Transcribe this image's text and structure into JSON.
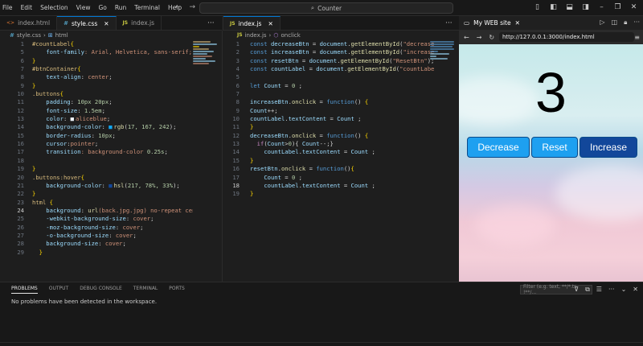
{
  "menu": [
    "File",
    "Edit",
    "Selection",
    "View",
    "Go",
    "Run",
    "Terminal",
    "Help"
  ],
  "command_center": {
    "text": "Counter"
  },
  "left_group": {
    "tabs": [
      {
        "label": "index.html",
        "type": "html"
      },
      {
        "label": "style.css",
        "type": "css",
        "active": true
      },
      {
        "label": "index.js",
        "type": "js"
      }
    ],
    "breadcrumb": {
      "file": "style.css",
      "symbol": "html"
    }
  },
  "mid_group": {
    "tabs": [
      {
        "label": "index.js",
        "type": "js",
        "active": true
      }
    ],
    "breadcrumb": {
      "file": "index.js",
      "symbol": "onclick"
    }
  },
  "css_lines": [
    "1",
    "5",
    "6",
    "7",
    "8",
    "9",
    "10",
    "11",
    "12",
    "13",
    "14",
    "15",
    "16",
    "17",
    "18",
    "19",
    "20",
    "21",
    "22",
    "23",
    "24",
    "25",
    "26",
    "27",
    "28",
    "29"
  ],
  "css_current_line": "24",
  "css_code": [
    [
      {
        "t": "#countLabel",
        "c": "sel"
      },
      {
        "t": "{",
        "c": "brk"
      }
    ],
    [
      {
        "t": "    font-family",
        "c": "prop"
      },
      {
        "t": ": Arial, Helvetica, sans-serif;",
        "c": "str"
      }
    ],
    [
      {
        "t": "}",
        "c": "brk"
      }
    ],
    [
      {
        "t": "#btnContainer",
        "c": "sel"
      },
      {
        "t": "{",
        "c": "brk"
      }
    ],
    [
      {
        "t": "    text-align",
        "c": "prop"
      },
      {
        "t": ": ",
        "c": "txt"
      },
      {
        "t": "center",
        "c": "str"
      },
      {
        "t": ";",
        "c": "txt"
      }
    ],
    [
      {
        "t": "}",
        "c": "brk"
      }
    ],
    [
      {
        "t": ".buttons",
        "c": "sel"
      },
      {
        "t": "{",
        "c": "brk"
      }
    ],
    [
      {
        "t": "    padding",
        "c": "prop"
      },
      {
        "t": ": ",
        "c": "txt"
      },
      {
        "t": "10px 20px",
        "c": "num"
      },
      {
        "t": ";",
        "c": "txt"
      }
    ],
    [
      {
        "t": "    font-size",
        "c": "prop"
      },
      {
        "t": ": ",
        "c": "txt"
      },
      {
        "t": "1.5em",
        "c": "num"
      },
      {
        "t": ";",
        "c": "txt"
      }
    ],
    [
      {
        "t": "    color",
        "c": "prop"
      },
      {
        "t": ": ",
        "c": "txt"
      },
      {
        "t": "■",
        "c": "sw1"
      },
      {
        "t": "aliceblue",
        "c": "str"
      },
      {
        "t": ";",
        "c": "txt"
      }
    ],
    [
      {
        "t": "    background-color",
        "c": "prop"
      },
      {
        "t": ": ",
        "c": "txt"
      },
      {
        "t": "■",
        "c": "sw2"
      },
      {
        "t": "rgb",
        "c": "fn"
      },
      {
        "t": "(",
        "c": "txt"
      },
      {
        "t": "17, 167, 242",
        "c": "num"
      },
      {
        "t": ");",
        "c": "txt"
      }
    ],
    [
      {
        "t": "    border-radius",
        "c": "prop"
      },
      {
        "t": ": ",
        "c": "txt"
      },
      {
        "t": "10px",
        "c": "num"
      },
      {
        "t": ";",
        "c": "txt"
      }
    ],
    [
      {
        "t": "    cursor",
        "c": "prop"
      },
      {
        "t": ":",
        "c": "txt"
      },
      {
        "t": "pointer",
        "c": "str"
      },
      {
        "t": ";",
        "c": "txt"
      }
    ],
    [
      {
        "t": "    transition",
        "c": "prop"
      },
      {
        "t": ": background-color ",
        "c": "str"
      },
      {
        "t": "0.25s",
        "c": "num"
      },
      {
        "t": ";",
        "c": "txt"
      }
    ],
    [
      {
        "t": "",
        "c": "txt"
      }
    ],
    [
      {
        "t": "}",
        "c": "brk"
      }
    ],
    [
      {
        "t": ".buttons:hover",
        "c": "sel"
      },
      {
        "t": "{",
        "c": "brk"
      }
    ],
    [
      {
        "t": "    background-color",
        "c": "prop"
      },
      {
        "t": ": ",
        "c": "txt"
      },
      {
        "t": "■",
        "c": "sw3"
      },
      {
        "t": "hsl",
        "c": "fn"
      },
      {
        "t": "(",
        "c": "txt"
      },
      {
        "t": "217, 78%, 33%",
        "c": "num"
      },
      {
        "t": ");",
        "c": "txt"
      }
    ],
    [
      {
        "t": "}",
        "c": "brk"
      }
    ],
    [
      {
        "t": "html ",
        "c": "sel"
      },
      {
        "t": "{",
        "c": "brk"
      }
    ],
    [
      {
        "t": "    background",
        "c": "prop"
      },
      {
        "t": ": ",
        "c": "txt"
      },
      {
        "t": "url",
        "c": "fn"
      },
      {
        "t": "(back.jpg.jpg)",
        "c": "str"
      },
      {
        "t": " no-repeat cente",
        "c": "str"
      }
    ],
    [
      {
        "t": "    -webkit-background-size",
        "c": "prop"
      },
      {
        "t": ": ",
        "c": "txt"
      },
      {
        "t": "cover",
        "c": "str"
      },
      {
        "t": ";",
        "c": "txt"
      }
    ],
    [
      {
        "t": "    -moz-background-size",
        "c": "prop"
      },
      {
        "t": ": ",
        "c": "txt"
      },
      {
        "t": "cover",
        "c": "str"
      },
      {
        "t": ";",
        "c": "txt"
      }
    ],
    [
      {
        "t": "    -o-background-size",
        "c": "prop"
      },
      {
        "t": ": ",
        "c": "txt"
      },
      {
        "t": "cover",
        "c": "str"
      },
      {
        "t": ";",
        "c": "txt"
      }
    ],
    [
      {
        "t": "    background-size",
        "c": "prop"
      },
      {
        "t": ": ",
        "c": "txt"
      },
      {
        "t": "cover",
        "c": "str"
      },
      {
        "t": ";",
        "c": "txt"
      }
    ],
    [
      {
        "t": "  }",
        "c": "brk"
      }
    ]
  ],
  "js_lines": [
    "1",
    "2",
    "3",
    "4",
    "5",
    "6",
    "7",
    "8",
    "9",
    "10",
    "11",
    "12",
    "13",
    "14",
    "15",
    "16",
    "17",
    "18",
    "19"
  ],
  "js_current_line": "18",
  "js_code": [
    [
      {
        "t": "const ",
        "c": "kw"
      },
      {
        "t": "decreaseBtn",
        "c": "var"
      },
      {
        "t": " = ",
        "c": "txt"
      },
      {
        "t": "document",
        "c": "var"
      },
      {
        "t": ".",
        "c": "txt"
      },
      {
        "t": "getElementById",
        "c": "fn"
      },
      {
        "t": "(",
        "c": "txt"
      },
      {
        "t": "\"decreaseB",
        "c": "str"
      }
    ],
    [
      {
        "t": "const ",
        "c": "kw"
      },
      {
        "t": "increaseBtn",
        "c": "var"
      },
      {
        "t": " = ",
        "c": "txt"
      },
      {
        "t": "document",
        "c": "var"
      },
      {
        "t": ".",
        "c": "txt"
      },
      {
        "t": "getElementById",
        "c": "fn"
      },
      {
        "t": "(",
        "c": "txt"
      },
      {
        "t": "\"increaseB",
        "c": "str"
      }
    ],
    [
      {
        "t": "const ",
        "c": "kw"
      },
      {
        "t": "resetBtn",
        "c": "var"
      },
      {
        "t": " = ",
        "c": "txt"
      },
      {
        "t": "document",
        "c": "var"
      },
      {
        "t": ".",
        "c": "txt"
      },
      {
        "t": "getElementById",
        "c": "fn"
      },
      {
        "t": "(",
        "c": "txt"
      },
      {
        "t": "\"ResetBtn\"",
        "c": "str"
      },
      {
        "t": ");",
        "c": "txt"
      }
    ],
    [
      {
        "t": "const ",
        "c": "kw"
      },
      {
        "t": "countLabel",
        "c": "var"
      },
      {
        "t": " = ",
        "c": "txt"
      },
      {
        "t": "document",
        "c": "var"
      },
      {
        "t": ".",
        "c": "txt"
      },
      {
        "t": "getElementById",
        "c": "fn"
      },
      {
        "t": "(",
        "c": "txt"
      },
      {
        "t": "\"countLabel\"",
        "c": "str"
      }
    ],
    [
      {
        "t": "",
        "c": "txt"
      }
    ],
    [
      {
        "t": "let ",
        "c": "kw"
      },
      {
        "t": "Count",
        "c": "var"
      },
      {
        "t": " = ",
        "c": "txt"
      },
      {
        "t": "0",
        "c": "num"
      },
      {
        "t": " ;",
        "c": "txt"
      }
    ],
    [
      {
        "t": "",
        "c": "txt"
      }
    ],
    [
      {
        "t": "increaseBtn",
        "c": "var"
      },
      {
        "t": ".",
        "c": "txt"
      },
      {
        "t": "onclick",
        "c": "fn"
      },
      {
        "t": " = ",
        "c": "txt"
      },
      {
        "t": "function",
        "c": "kw"
      },
      {
        "t": "() ",
        "c": "txt"
      },
      {
        "t": "{",
        "c": "brk"
      }
    ],
    [
      {
        "t": "Count",
        "c": "var"
      },
      {
        "t": "++;",
        "c": "txt"
      }
    ],
    [
      {
        "t": "countLabel",
        "c": "var"
      },
      {
        "t": ".",
        "c": "txt"
      },
      {
        "t": "textContent",
        "c": "var"
      },
      {
        "t": " = ",
        "c": "txt"
      },
      {
        "t": "Count",
        "c": "var"
      },
      {
        "t": " ;",
        "c": "txt"
      }
    ],
    [
      {
        "t": "}",
        "c": "brk"
      }
    ],
    [
      {
        "t": "decreaseBtn",
        "c": "var"
      },
      {
        "t": ".",
        "c": "txt"
      },
      {
        "t": "onclick",
        "c": "fn"
      },
      {
        "t": " = ",
        "c": "txt"
      },
      {
        "t": "function",
        "c": "kw"
      },
      {
        "t": "() ",
        "c": "txt"
      },
      {
        "t": "{",
        "c": "brk"
      }
    ],
    [
      {
        "t": "  ",
        "c": "txt"
      },
      {
        "t": "if",
        "c": "ctl"
      },
      {
        "t": "(",
        "c": "txt"
      },
      {
        "t": "Count",
        "c": "var"
      },
      {
        "t": ">",
        "c": "txt"
      },
      {
        "t": "0",
        "c": "num"
      },
      {
        "t": "){ ",
        "c": "txt"
      },
      {
        "t": "Count",
        "c": "var"
      },
      {
        "t": "--;}",
        "c": "txt"
      }
    ],
    [
      {
        "t": "    ",
        "c": "txt"
      },
      {
        "t": "countLabel",
        "c": "var"
      },
      {
        "t": ".",
        "c": "txt"
      },
      {
        "t": "textContent",
        "c": "var"
      },
      {
        "t": " = ",
        "c": "txt"
      },
      {
        "t": "Count",
        "c": "var"
      },
      {
        "t": " ;",
        "c": "txt"
      }
    ],
    [
      {
        "t": "}",
        "c": "brk"
      }
    ],
    [
      {
        "t": "resetBtn",
        "c": "var"
      },
      {
        "t": ".",
        "c": "txt"
      },
      {
        "t": "onclick",
        "c": "fn"
      },
      {
        "t": " = ",
        "c": "txt"
      },
      {
        "t": "function",
        "c": "kw"
      },
      {
        "t": "()",
        "c": "txt"
      },
      {
        "t": "{",
        "c": "brk"
      }
    ],
    [
      {
        "t": "    ",
        "c": "txt"
      },
      {
        "t": "Count",
        "c": "var"
      },
      {
        "t": " = ",
        "c": "txt"
      },
      {
        "t": "0",
        "c": "num"
      },
      {
        "t": " ;",
        "c": "txt"
      }
    ],
    [
      {
        "t": "    ",
        "c": "txt"
      },
      {
        "t": "countLabel",
        "c": "var"
      },
      {
        "t": ".",
        "c": "txt"
      },
      {
        "t": "textContent",
        "c": "var"
      },
      {
        "t": " = ",
        "c": "txt"
      },
      {
        "t": "Count",
        "c": "var"
      },
      {
        "t": " ;",
        "c": "txt"
      }
    ],
    [
      {
        "t": "}",
        "c": "brk"
      }
    ]
  ],
  "browser": {
    "tab_title": "My WEB site",
    "url": "http://127.0.0.1:3000/index.html",
    "count": "3",
    "buttons": {
      "decrease": "Decrease",
      "reset": "Reset",
      "increase": "Increase"
    },
    "colors": {
      "button": "#11a7f2",
      "button_hover": "#12479a"
    }
  },
  "panel": {
    "tabs": [
      "PROBLEMS",
      "OUTPUT",
      "DEBUG CONSOLE",
      "TERMINAL",
      "PORTS"
    ],
    "message": "No problems have been detected in the workspace.",
    "filter_placeholder": "Filter (e.g. text, **/*.ts, !**/..."
  }
}
